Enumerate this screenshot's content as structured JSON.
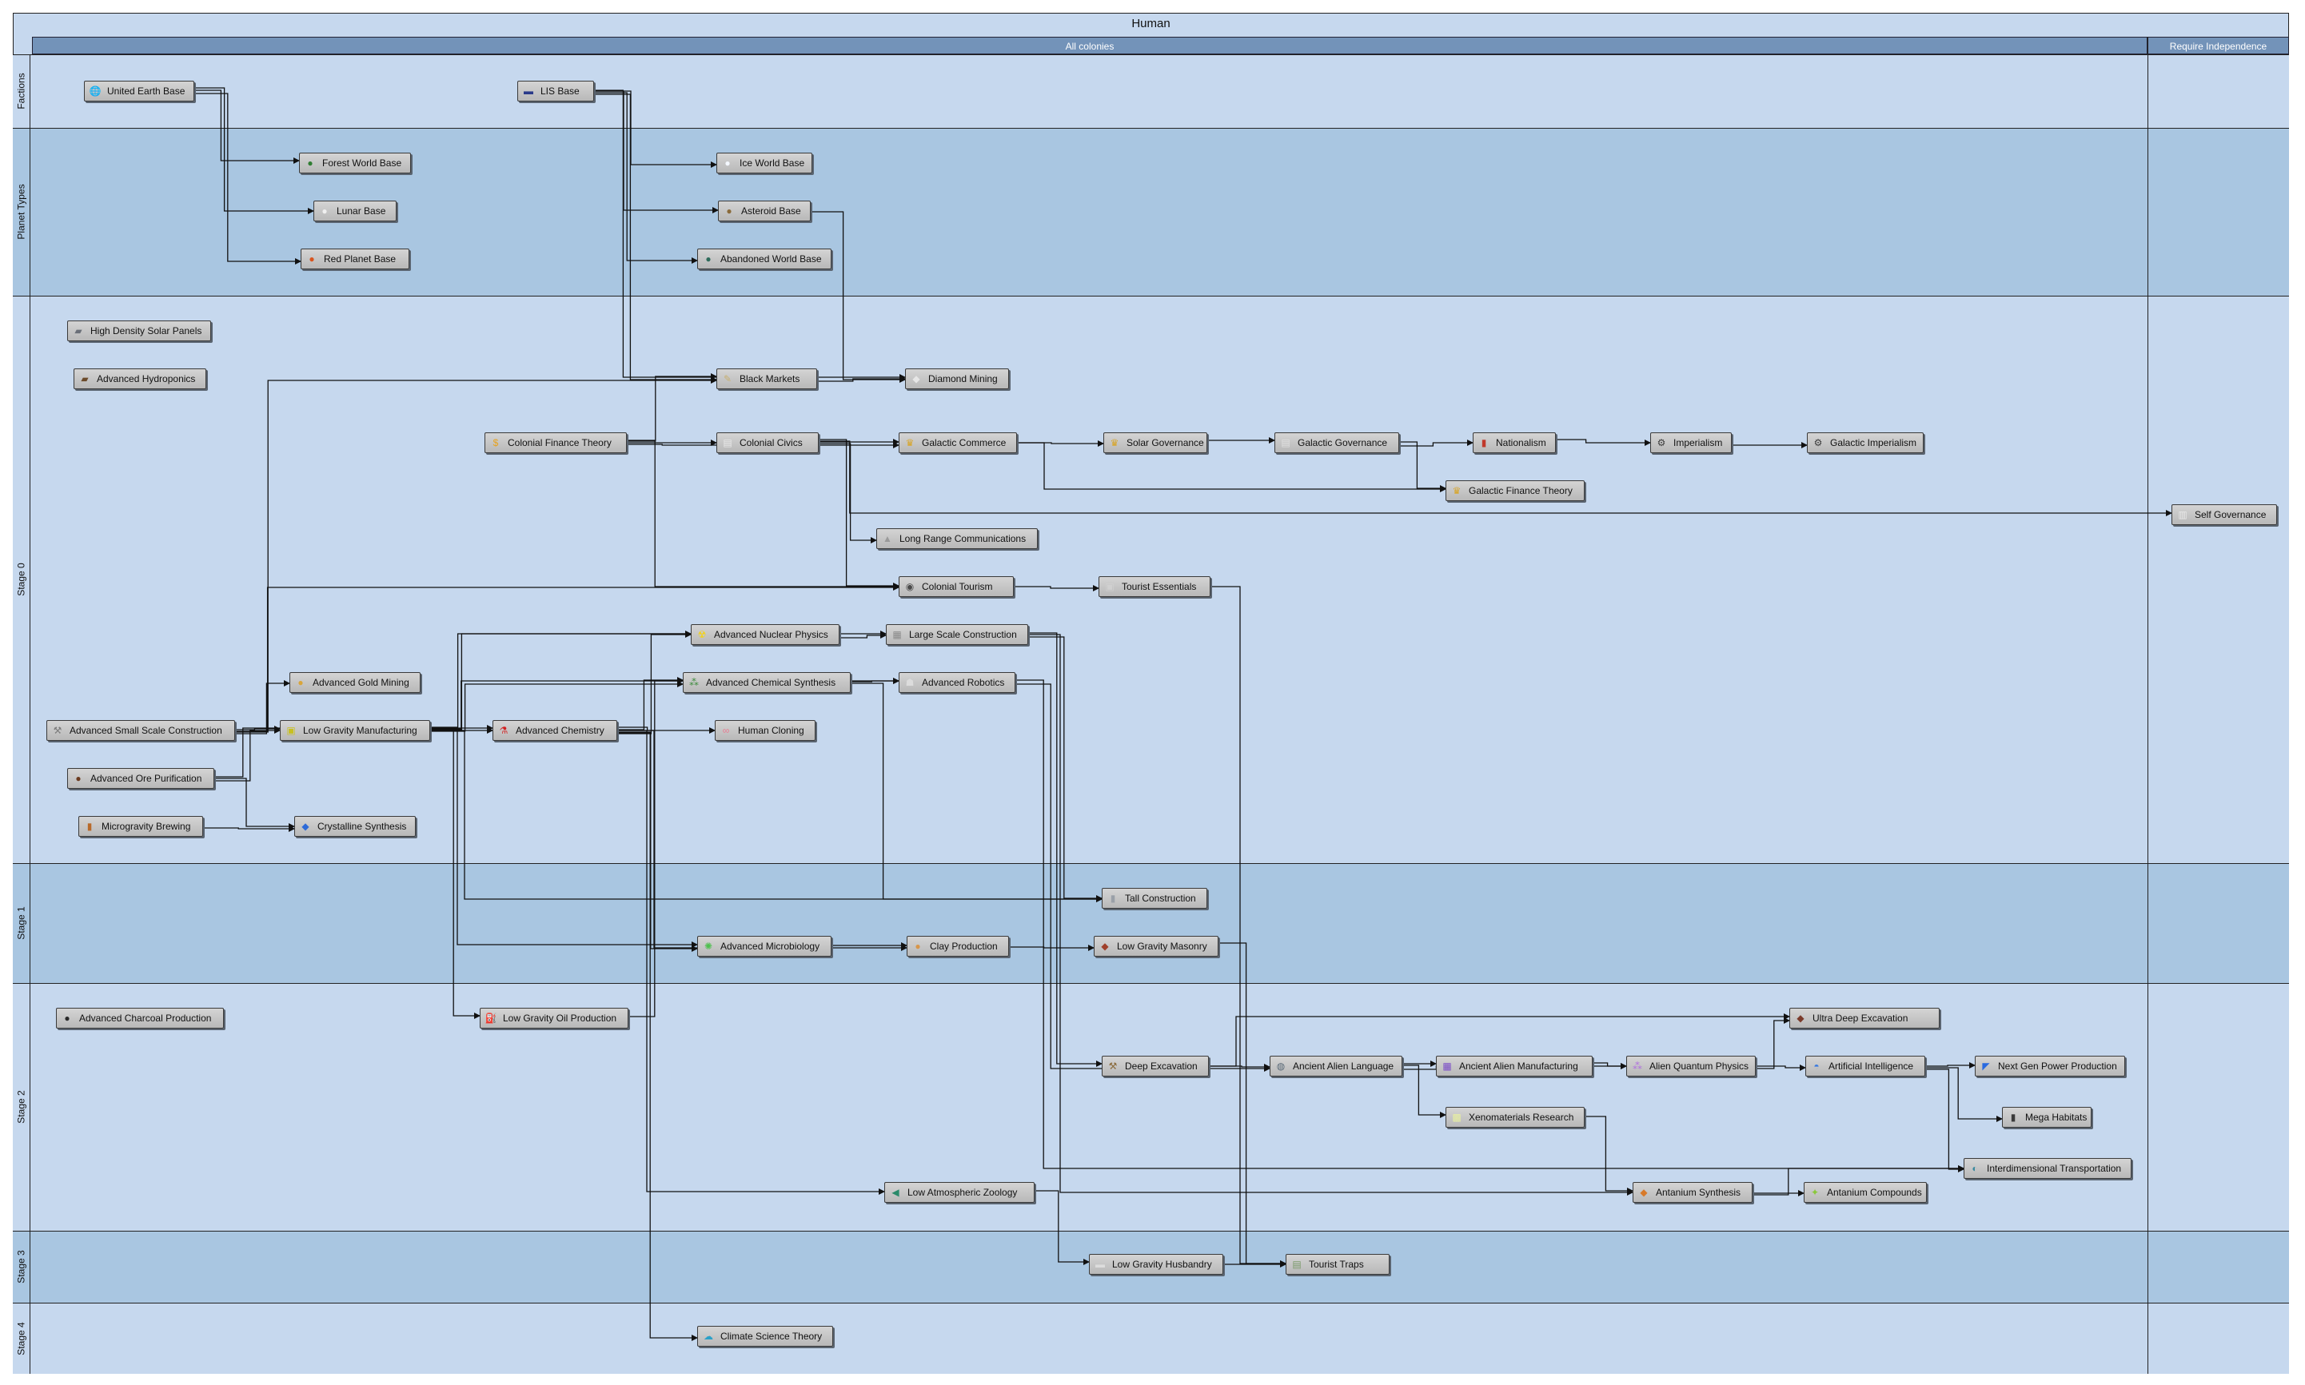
{
  "diagram": {
    "title": "Human",
    "columns": [
      {
        "label": "All colonies"
      },
      {
        "label": "Require Independence"
      }
    ],
    "lanes": [
      {
        "label": "Factions"
      },
      {
        "label": "Planet Types"
      },
      {
        "label": "Stage 0"
      },
      {
        "label": "Stage 1"
      },
      {
        "label": "Stage 2"
      },
      {
        "label": "Stage 3"
      },
      {
        "label": "Stage 4"
      }
    ],
    "nodes": [
      {
        "id": "ueb",
        "label": "United Earth Base",
        "icon": "globe-icon",
        "color": "#3f8fd0"
      },
      {
        "id": "lis",
        "label": "LIS Base",
        "icon": "flag-icon",
        "color": "#2a3a8a"
      },
      {
        "id": "fwb",
        "label": "Forest World Base",
        "icon": "forest-planet-icon",
        "color": "#2f7d32"
      },
      {
        "id": "lunar",
        "label": "Lunar Base",
        "icon": "moon-icon",
        "color": "#f0f0f0"
      },
      {
        "id": "rpb",
        "label": "Red Planet Base",
        "icon": "red-planet-icon",
        "color": "#d9541e"
      },
      {
        "id": "iwb",
        "label": "Ice World Base",
        "icon": "ice-planet-icon",
        "color": "#f4f8ff"
      },
      {
        "id": "ast",
        "label": "Asteroid Base",
        "icon": "asteroid-icon",
        "color": "#8a6a3a"
      },
      {
        "id": "awb",
        "label": "Abandoned World Base",
        "icon": "abandoned-planet-icon",
        "color": "#2e6b5b"
      },
      {
        "id": "hdsp",
        "label": "High Density Solar Panels",
        "icon": "solar-panel-icon",
        "color": "#6a6f78"
      },
      {
        "id": "ahyd",
        "label": "Advanced Hydroponics",
        "icon": "hydroponics-icon",
        "color": "#6b4a2a"
      },
      {
        "id": "bm",
        "label": "Black Markets",
        "icon": "syringe-icon",
        "color": "#c8b070"
      },
      {
        "id": "dm",
        "label": "Diamond Mining",
        "icon": "diamond-icon",
        "color": "#e6e6e6"
      },
      {
        "id": "cft",
        "label": "Colonial Finance Theory",
        "icon": "coin-icon",
        "color": "#e8a21c"
      },
      {
        "id": "cc",
        "label": "Colonial Civics",
        "icon": "book-icon",
        "color": "#e8e8e8"
      },
      {
        "id": "gc",
        "label": "Galactic Commerce",
        "icon": "trophy-icon",
        "color": "#d8a528"
      },
      {
        "id": "sg",
        "label": "Solar Governance",
        "icon": "trophy-icon",
        "color": "#d8a528"
      },
      {
        "id": "gg",
        "label": "Galactic Governance",
        "icon": "stack-icon",
        "color": "#e0e0e0"
      },
      {
        "id": "nat",
        "label": "Nationalism",
        "icon": "torch-icon",
        "color": "#c0392b"
      },
      {
        "id": "imp",
        "label": "Imperialism",
        "icon": "machine-icon",
        "color": "#3a3a3a"
      },
      {
        "id": "gimp",
        "label": "Galactic Imperialism",
        "icon": "machine-icon",
        "color": "#3a3a3a"
      },
      {
        "id": "gft",
        "label": "Galactic Finance Theory",
        "icon": "trophy-icon",
        "color": "#d8a528"
      },
      {
        "id": "selfg",
        "label": "Self Governance",
        "icon": "monument-icon",
        "color": "#e8e8e8"
      },
      {
        "id": "lrc",
        "label": "Long Range Communications",
        "icon": "satellite-icon",
        "color": "#9a9a9a"
      },
      {
        "id": "ct",
        "label": "Colonial Tourism",
        "icon": "camera-icon",
        "color": "#4a4a4a"
      },
      {
        "id": "te",
        "label": "Tourist Essentials",
        "icon": "luggage-icon",
        "color": "#d0d0d0"
      },
      {
        "id": "anp",
        "label": "Advanced Nuclear Physics",
        "icon": "radiation-icon",
        "color": "#f2d21b"
      },
      {
        "id": "lsc",
        "label": "Large Scale Construction",
        "icon": "building-icon",
        "color": "#8a8a8a"
      },
      {
        "id": "acs",
        "label": "Advanced Chemical Synthesis",
        "icon": "molecule-icon",
        "color": "#3a8a3a"
      },
      {
        "id": "ar",
        "label": "Advanced Robotics",
        "icon": "robot-icon",
        "color": "#dcdcdc"
      },
      {
        "id": "agm",
        "label": "Advanced Gold Mining",
        "icon": "gold-ore-icon",
        "color": "#d9a53a"
      },
      {
        "id": "assc",
        "label": "Advanced Small Scale Construction",
        "icon": "tools-icon",
        "color": "#7a7a7a"
      },
      {
        "id": "lgm",
        "label": "Low Gravity Manufacturing",
        "icon": "chip-icon",
        "color": "#c8c020"
      },
      {
        "id": "achem",
        "label": "Advanced Chemistry",
        "icon": "flask-icon",
        "color": "#d22222"
      },
      {
        "id": "hc",
        "label": "Human Cloning",
        "icon": "dna-icon",
        "color": "#e87a90"
      },
      {
        "id": "aop",
        "label": "Advanced Ore Purification",
        "icon": "ore-icon",
        "color": "#6b3a1e"
      },
      {
        "id": "mb",
        "label": "Microgravity Brewing",
        "icon": "beer-icon",
        "color": "#b86a2a"
      },
      {
        "id": "cs",
        "label": "Crystalline Synthesis",
        "icon": "crystal-icon",
        "color": "#2d6ad8"
      },
      {
        "id": "tc",
        "label": "Tall Construction",
        "icon": "tower-icon",
        "color": "#9aa0a8"
      },
      {
        "id": "amb",
        "label": "Advanced Microbiology",
        "icon": "microbe-icon",
        "color": "#4ec04e"
      },
      {
        "id": "clay",
        "label": "Clay Production",
        "icon": "clay-icon",
        "color": "#d8964a"
      },
      {
        "id": "lgmas",
        "label": "Low Gravity Masonry",
        "icon": "brick-icon",
        "color": "#a0402a"
      },
      {
        "id": "acp",
        "label": "Advanced Charcoal Production",
        "icon": "charcoal-icon",
        "color": "#2a2a2a"
      },
      {
        "id": "lgop",
        "label": "Low Gravity Oil Production",
        "icon": "oil-rig-icon",
        "color": "#ffffff"
      },
      {
        "id": "de",
        "label": "Deep Excavation",
        "icon": "shovel-icon",
        "color": "#8a6a3a"
      },
      {
        "id": "aal",
        "label": "Ancient Alien Language",
        "icon": "tablet-icon",
        "color": "#5a6a78"
      },
      {
        "id": "aam",
        "label": "Ancient Alien Manufacturing",
        "icon": "alien-machine-icon",
        "color": "#7a4ac8"
      },
      {
        "id": "aqp",
        "label": "Alien Quantum Physics",
        "icon": "quantum-icon",
        "color": "#b070e0"
      },
      {
        "id": "ai",
        "label": "Artificial Intelligence",
        "icon": "brain-icon",
        "color": "#3a7ae0"
      },
      {
        "id": "ngpp",
        "label": "Next Gen Power Production",
        "icon": "power-icon",
        "color": "#2a6ae0"
      },
      {
        "id": "mh",
        "label": "Mega Habitats",
        "icon": "habitat-icon",
        "color": "#3a3a3a"
      },
      {
        "id": "xr",
        "label": "Xenomaterials Research",
        "icon": "xeno-icon",
        "color": "#e8f0a0"
      },
      {
        "id": "it",
        "label": "Interdimensional Transportation",
        "icon": "portal-icon",
        "color": "#3a8aa0"
      },
      {
        "id": "ude",
        "label": "Ultra Deep Excavation",
        "icon": "drill-icon",
        "color": "#7a3a2a"
      },
      {
        "id": "las",
        "label": "Low Atmospheric Zoology",
        "icon": "fish-icon",
        "color": "#2a8a6a"
      },
      {
        "id": "antsyn",
        "label": "Antanium Synthesis",
        "icon": "antanium-icon",
        "color": "#d87a2a"
      },
      {
        "id": "antc",
        "label": "Antanium Compounds",
        "icon": "antanium-compound-icon",
        "color": "#8ac83a"
      },
      {
        "id": "lgh",
        "label": "Low Gravity Husbandry",
        "icon": "animal-icon",
        "color": "#dcdcdc"
      },
      {
        "id": "tt",
        "label": "Tourist Traps",
        "icon": "souvenir-icon",
        "color": "#7a9a6a"
      },
      {
        "id": "cst",
        "label": "Climate Science Theory",
        "icon": "climate-icon",
        "color": "#2aa0c8"
      }
    ],
    "edges": [
      [
        "ueb",
        "fwb"
      ],
      [
        "ueb",
        "lunar"
      ],
      [
        "ueb",
        "rpb"
      ],
      [
        "lis",
        "iwb"
      ],
      [
        "lis",
        "ast"
      ],
      [
        "lis",
        "awb"
      ],
      [
        "lis",
        "bm"
      ],
      [
        "lis",
        "dm"
      ],
      [
        "ast",
        "dm"
      ],
      [
        "bm",
        "dm"
      ],
      [
        "cft",
        "bm"
      ],
      [
        "cft",
        "cc"
      ],
      [
        "cft",
        "gc"
      ],
      [
        "cft",
        "ct"
      ],
      [
        "cc",
        "gc"
      ],
      [
        "cc",
        "lrc"
      ],
      [
        "cc",
        "ct"
      ],
      [
        "cc",
        "selfg"
      ],
      [
        "gc",
        "sg"
      ],
      [
        "gc",
        "gft"
      ],
      [
        "sg",
        "gg"
      ],
      [
        "gg",
        "nat"
      ],
      [
        "gg",
        "gft"
      ],
      [
        "nat",
        "imp"
      ],
      [
        "imp",
        "gimp"
      ],
      [
        "ct",
        "te"
      ],
      [
        "te",
        "tt"
      ],
      [
        "assc",
        "bm"
      ],
      [
        "assc",
        "agm"
      ],
      [
        "assc",
        "lgm"
      ],
      [
        "assc",
        "ct"
      ],
      [
        "aop",
        "lgm"
      ],
      [
        "aop",
        "achem"
      ],
      [
        "aop",
        "cs"
      ],
      [
        "mb",
        "cs"
      ],
      [
        "lgm",
        "achem"
      ],
      [
        "lgm",
        "anp"
      ],
      [
        "lgm",
        "acs"
      ],
      [
        "lgm",
        "lsc"
      ],
      [
        "lgm",
        "ar"
      ],
      [
        "lgm",
        "tc"
      ],
      [
        "lgm",
        "amb"
      ],
      [
        "lgm",
        "lgop"
      ],
      [
        "achem",
        "anp"
      ],
      [
        "achem",
        "acs"
      ],
      [
        "achem",
        "hc"
      ],
      [
        "achem",
        "amb"
      ],
      [
        "achem",
        "clay"
      ],
      [
        "achem",
        "las"
      ],
      [
        "achem",
        "cst"
      ],
      [
        "anp",
        "lsc"
      ],
      [
        "acs",
        "ar"
      ],
      [
        "acs",
        "tc"
      ],
      [
        "lsc",
        "tc"
      ],
      [
        "lsc",
        "de"
      ],
      [
        "lsc",
        "antsyn"
      ],
      [
        "ar",
        "aal"
      ],
      [
        "ar",
        "it"
      ],
      [
        "amb",
        "clay"
      ],
      [
        "clay",
        "lgmas"
      ],
      [
        "lgmas",
        "tt"
      ],
      [
        "lgop",
        "acs"
      ],
      [
        "de",
        "aal"
      ],
      [
        "de",
        "ude"
      ],
      [
        "aal",
        "aam"
      ],
      [
        "aal",
        "aqp"
      ],
      [
        "aal",
        "xr"
      ],
      [
        "aam",
        "aqp"
      ],
      [
        "aqp",
        "ude"
      ],
      [
        "aqp",
        "ai"
      ],
      [
        "ai",
        "ngpp"
      ],
      [
        "ai",
        "mh"
      ],
      [
        "ai",
        "it"
      ],
      [
        "xr",
        "antsyn"
      ],
      [
        "antsyn",
        "antc"
      ],
      [
        "antsyn",
        "it"
      ],
      [
        "las",
        "lgh"
      ],
      [
        "lgh",
        "tt"
      ]
    ]
  }
}
